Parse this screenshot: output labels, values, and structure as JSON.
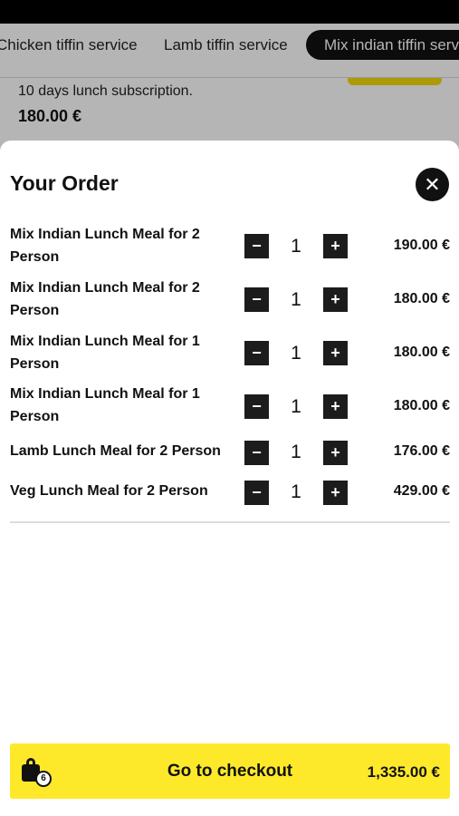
{
  "background": {
    "tabs": [
      {
        "label": "Chicken tiffin service"
      },
      {
        "label": "Lamb tiffin service"
      },
      {
        "label": "Mix indian tiffin service"
      }
    ],
    "description": "10 days lunch subscription.",
    "price": "180.00 €"
  },
  "order": {
    "title": "Your Order",
    "close_icon": "close-icon",
    "items": [
      {
        "name": "Mix Indian Lunch Meal for 2 Person",
        "qty": "1",
        "price": "190.00 €"
      },
      {
        "name": "Mix Indian Lunch Meal for 2 Person",
        "qty": "1",
        "price": "180.00 €"
      },
      {
        "name": "Mix Indian Lunch Meal for 1 Person",
        "qty": "1",
        "price": "180.00 €"
      },
      {
        "name": "Mix Indian Lunch Meal for 1 Person",
        "qty": "1",
        "price": "180.00 €"
      },
      {
        "name": "Lamb Lunch Meal for 2 Person",
        "qty": "1",
        "price": "176.00 €"
      },
      {
        "name": "Veg Lunch Meal for 2 Person",
        "qty": "1",
        "price": "429.00 €"
      }
    ],
    "minus_symbol": "−",
    "plus_symbol": "+"
  },
  "checkout": {
    "label": "Go to checkout",
    "total": "1,335.00 €",
    "cart_count": "6",
    "icon": "shopping-bag-icon",
    "color": "#fde92a"
  }
}
